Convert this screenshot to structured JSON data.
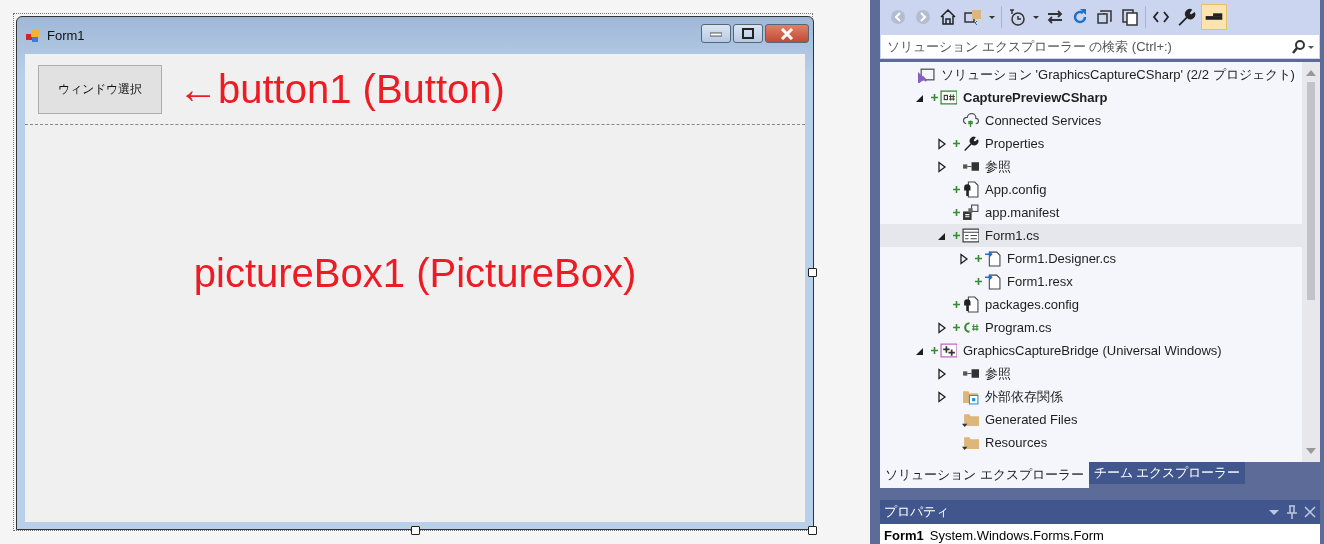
{
  "designer": {
    "form": {
      "title": "Form1",
      "button": "ウィンドウ選択",
      "annotations": [
        {
          "kind": "button-note",
          "text": "←button1 (Button)"
        },
        {
          "kind": "picture-note",
          "text": "pictureBox1 (PictureBox)"
        }
      ]
    }
  },
  "solution_explorer": {
    "search": {
      "placeholder": "ソリューション エクスプローラー の検索 (Ctrl+:)"
    },
    "tree": [
      {
        "label": "ソリューション 'GraphicsCaptureCSharp' (2/2 プロジェクト)",
        "kind": "solution",
        "added": false,
        "bold": false,
        "selected": false,
        "children": [
          {
            "label": "CapturePreviewCSharp",
            "kind": "csharp-project",
            "expanded": true,
            "added": true,
            "bold": true,
            "selected": false,
            "children": [
              {
                "label": "Connected Services",
                "kind": "connected",
                "added": false,
                "bold": false,
                "selected": false
              },
              {
                "label": "Properties",
                "kind": "wrench",
                "expanded": false,
                "added": true,
                "bold": false,
                "selected": false
              },
              {
                "label": "参照",
                "kind": "references",
                "expanded": false,
                "added": false,
                "bold": false,
                "selected": false
              },
              {
                "label": "App.config",
                "kind": "config",
                "added": true,
                "bold": false,
                "selected": false
              },
              {
                "label": "app.manifest",
                "kind": "manifest",
                "added": true,
                "bold": false,
                "selected": false
              },
              {
                "label": "Form1.cs",
                "kind": "form",
                "expanded": true,
                "added": true,
                "bold": false,
                "selected": true,
                "children": [
                  {
                    "label": "Form1.Designer.cs",
                    "kind": "code-file",
                    "expanded": false,
                    "added": true,
                    "bold": false,
                    "selected": false
                  },
                  {
                    "label": "Form1.resx",
                    "kind": "code-file",
                    "added": true,
                    "bold": false,
                    "selected": false
                  }
                ]
              },
              {
                "label": "packages.config",
                "kind": "config",
                "added": true,
                "bold": false,
                "selected": false
              },
              {
                "label": "Program.cs",
                "kind": "csharp-file",
                "expanded": false,
                "added": true,
                "bold": false,
                "selected": false
              }
            ]
          },
          {
            "label": "GraphicsCaptureBridge (Universal Windows)",
            "kind": "uwp-project",
            "expanded": true,
            "added": true,
            "bold": false,
            "selected": false,
            "children": [
              {
                "label": "参照",
                "kind": "references",
                "expanded": false,
                "added": false,
                "bold": false,
                "selected": false
              },
              {
                "label": "外部依存関係",
                "kind": "external",
                "expanded": false,
                "added": false,
                "bold": false,
                "selected": false
              },
              {
                "label": "Generated Files",
                "kind": "folder",
                "added": false,
                "bold": false,
                "selected": false
              },
              {
                "label": "Resources",
                "kind": "folder",
                "added": false,
                "bold": false,
                "selected": false
              }
            ]
          }
        ]
      }
    ],
    "tabs": [
      {
        "label": "ソリューション エクスプローラー",
        "selected": true
      },
      {
        "label": "チーム エクスプローラー",
        "selected": false
      }
    ]
  },
  "properties": {
    "title": "プロパティ",
    "object_name": "Form1",
    "object_type": "System.Windows.Forms.Form"
  }
}
